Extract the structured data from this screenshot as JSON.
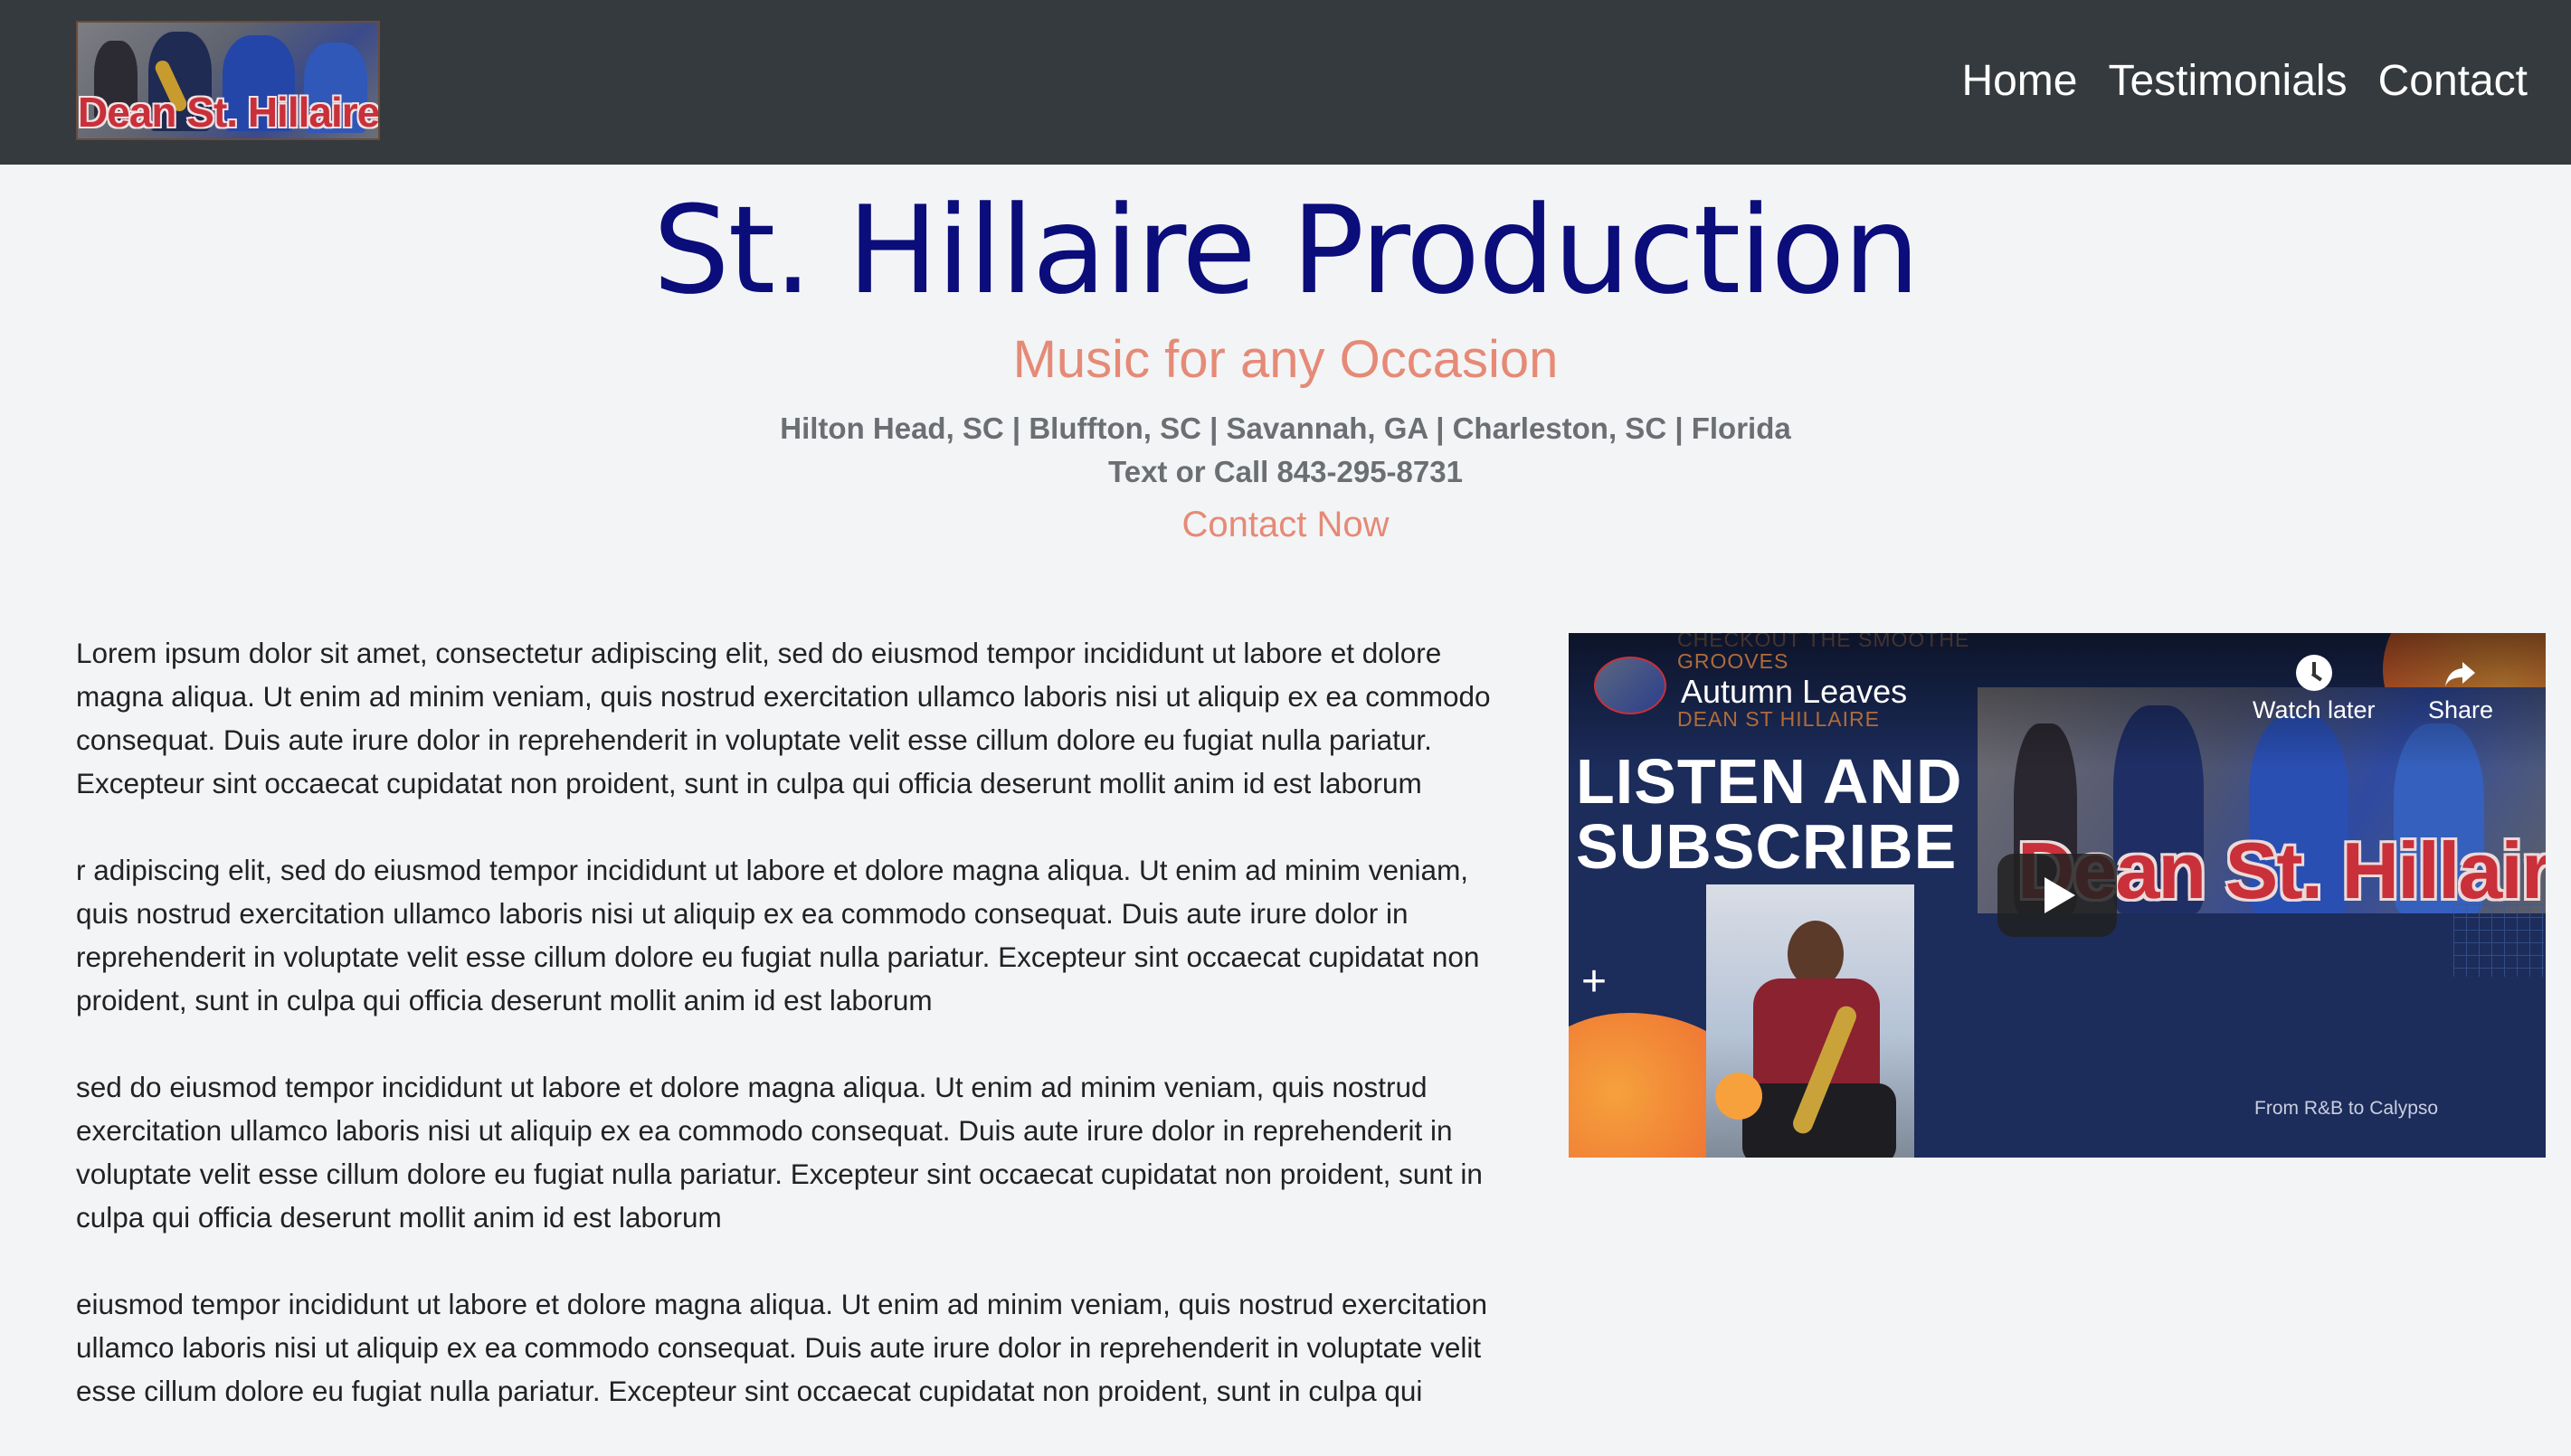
{
  "header": {
    "logo_text": "Dean St. Hillaire",
    "nav": [
      "Home",
      "Testimonials",
      "Contact"
    ]
  },
  "hero": {
    "title": "St. Hillaire Production",
    "tagline": "Music for any Occasion",
    "areas": "Hilton Head, SC | Bluffton, SC | Savannah, GA | Charleston, SC | Florida",
    "phone": "Text or Call 843-295-8731",
    "contact_link": "Contact Now"
  },
  "content": {
    "paragraphs": [
      "Lorem ipsum dolor sit amet, consectetur adipiscing elit, sed do eiusmod tempor incididunt ut labore et dolore magna aliqua. Ut enim ad minim veniam, quis nostrud exercitation ullamco laboris nisi ut aliquip ex ea commodo consequat. Duis aute irure dolor in reprehenderit in voluptate velit esse cillum dolore eu fugiat nulla pariatur. Excepteur sint occaecat cupidatat non proident, sunt in culpa qui officia deserunt mollit anim id est laborum",
      "r adipiscing elit, sed do eiusmod tempor incididunt ut labore et dolore magna aliqua. Ut enim ad minim veniam, quis nostrud exercitation ullamco laboris nisi ut aliquip ex ea commodo consequat. Duis aute irure dolor in reprehenderit in voluptate velit esse cillum dolore eu fugiat nulla pariatur. Excepteur sint occaecat cupidatat non proident, sunt in culpa qui officia deserunt mollit anim id est laborum",
      "sed do eiusmod tempor incididunt ut labore et dolore magna aliqua. Ut enim ad minim veniam, quis nostrud exercitation ullamco laboris nisi ut aliquip ex ea commodo consequat. Duis aute irure dolor in reprehenderit in voluptate velit esse cillum dolore eu fugiat nulla pariatur. Excepteur sint occaecat cupidatat non proident, sunt in culpa qui officia deserunt mollit anim id est laborum",
      "eiusmod tempor incididunt ut labore et dolore magna aliqua. Ut enim ad minim veniam, quis nostrud exercitation ullamco laboris nisi ut aliquip ex ea commodo consequat. Duis aute irure dolor in reprehenderit in voluptate velit esse cillum dolore eu fugiat nulla pariatur. Excepteur sint occaecat cupidatat non proident, sunt in culpa qui"
    ]
  },
  "video": {
    "title": "Autumn Leaves",
    "overlay_line1": "CHECKOUT THE SMOOTHE",
    "overlay_line2": "GROOVES",
    "overlay_line3": "DEAN ST HILLAIRE",
    "listen_line1": "LISTEN AND",
    "listen_line2": "SUBSCRIBE",
    "watch_later": "Watch later",
    "share": "Share",
    "logo_text": "Dean St. Hillaire",
    "footer_text": "From R&B to Calypso",
    "icons": [
      "clock-icon",
      "share-icon",
      "play-icon",
      "plus-icon"
    ]
  },
  "colors": {
    "navbar": "#343a3d",
    "title": "#0b0d7a",
    "accent": "#e58a76",
    "muted": "#6b6e72",
    "background": "#f3f4f6"
  }
}
